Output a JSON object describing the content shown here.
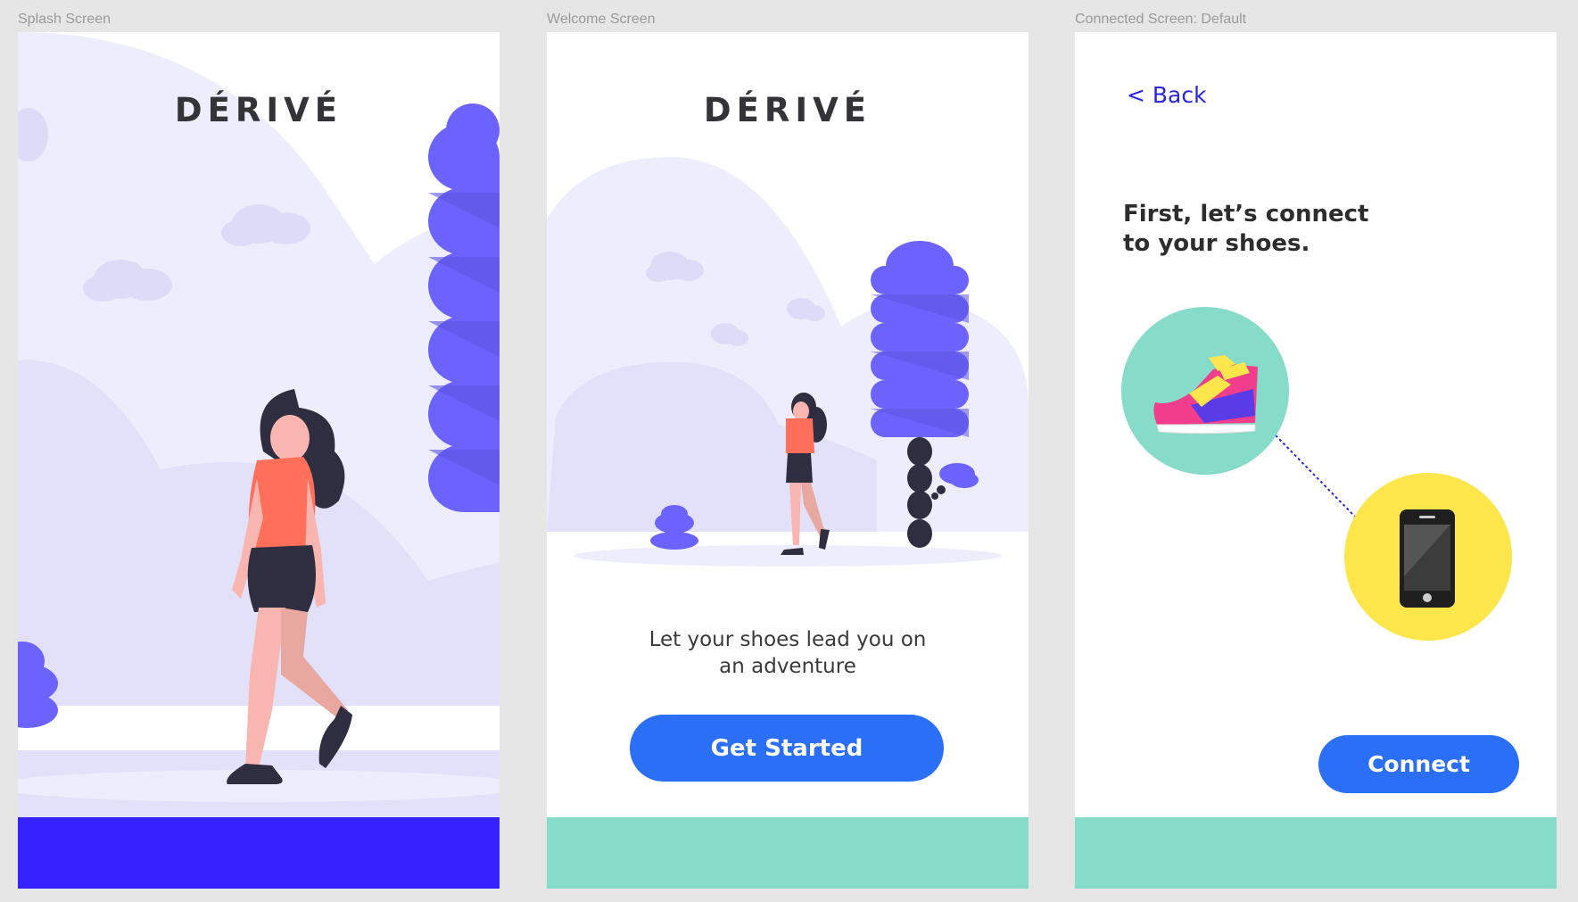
{
  "frames": {
    "splash": {
      "label": "Splash Screen",
      "logo": "DÉRIVÉ"
    },
    "welcome": {
      "label": "Welcome Screen",
      "logo": "DÉRIVÉ",
      "tagline_line1": "Let your shoes lead you on",
      "tagline_line2": "an adventure",
      "cta_label": "Get Started"
    },
    "connect": {
      "label": "Connected Screen: Default",
      "back_label": "< Back",
      "heading_line1": "First, let’s connect",
      "heading_line2": "to your shoes.",
      "cta_label": "Connect"
    }
  },
  "icons": {
    "shoe": "sneaker-icon",
    "phone": "smartphone-icon"
  },
  "colors": {
    "canvas": "#e6e6e6",
    "logo_text": "#333338",
    "splash_footer": "#3522ff",
    "teal_footer": "#86dcc8",
    "primary_button": "#2a6ff5",
    "back_link": "#2a25e0",
    "illustration_purple": "#6c63ff",
    "illustration_bg": "#eeedfd",
    "shoe_circle": "#86dcc8",
    "phone_circle": "#fde64b"
  }
}
